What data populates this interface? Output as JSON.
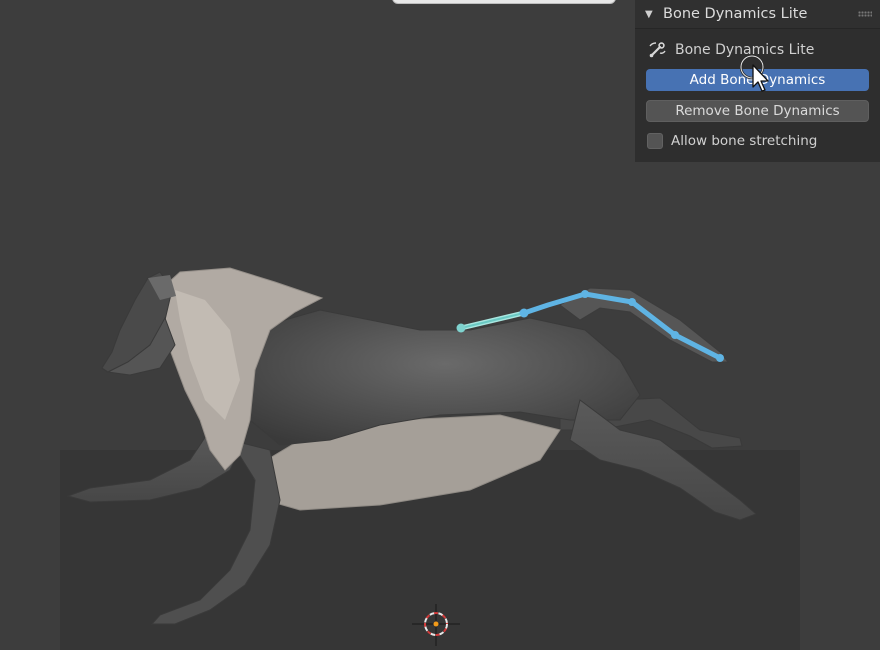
{
  "panel": {
    "title": "Bone Dynamics Lite",
    "label": "Bone Dynamics Lite",
    "add_button": "Add Bone Dynamics",
    "remove_button": "Remove Bone Dynamics",
    "checkbox_label": "Allow bone stretching",
    "checkbox_checked": false
  },
  "icons": {
    "collapse": "triangle-down-icon",
    "drag": "drag-grip-icon",
    "bone_dynamics": "bone-dynamics-icon",
    "cursor": "mouse-pointer-icon",
    "scene_cursor": "3d-cursor-icon"
  },
  "colors": {
    "viewport_bg": "#3d3d3d",
    "panel_bg": "#2e2e2e",
    "primary_button": "#4772b3",
    "bone_highlight": "#5fb4e4"
  }
}
